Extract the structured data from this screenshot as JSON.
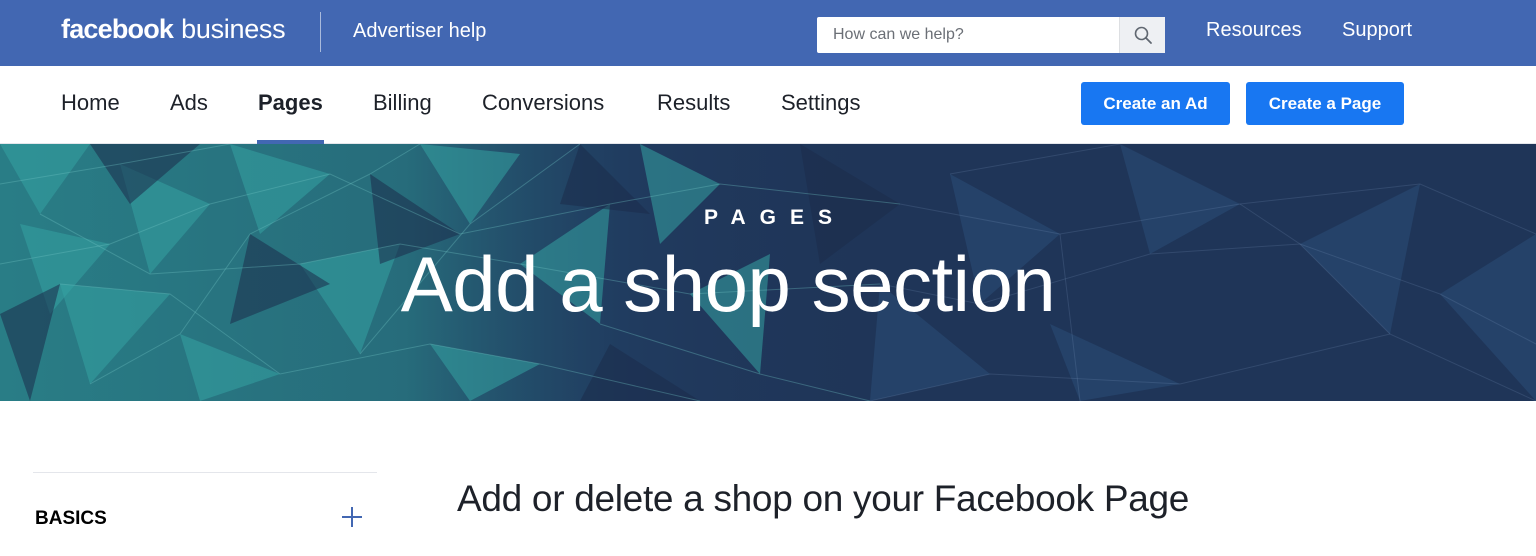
{
  "topbar": {
    "brand_bold": "facebook",
    "brand_light": "business",
    "advertiser_help": "Advertiser help",
    "search": {
      "placeholder": "How can we help?",
      "icon": "search-icon"
    },
    "links": [
      "Resources",
      "Support"
    ]
  },
  "subnav": {
    "items": [
      "Home",
      "Ads",
      "Pages",
      "Billing",
      "Conversions",
      "Results",
      "Settings"
    ],
    "active": "Pages",
    "buttons": {
      "create_ad": "Create an Ad",
      "create_page": "Create a Page"
    }
  },
  "hero": {
    "eyebrow": "PAGES",
    "title": "Add a shop section"
  },
  "sidebar": {
    "heading": "BASICS",
    "expand_icon": "plus-icon"
  },
  "article": {
    "title": "Add or delete a shop on your Facebook Page"
  },
  "colors": {
    "brand_blue": "#4267b2",
    "button_blue": "#1877f2",
    "hero_navy": "#1f3558",
    "hero_teal": "#2e8f93"
  }
}
